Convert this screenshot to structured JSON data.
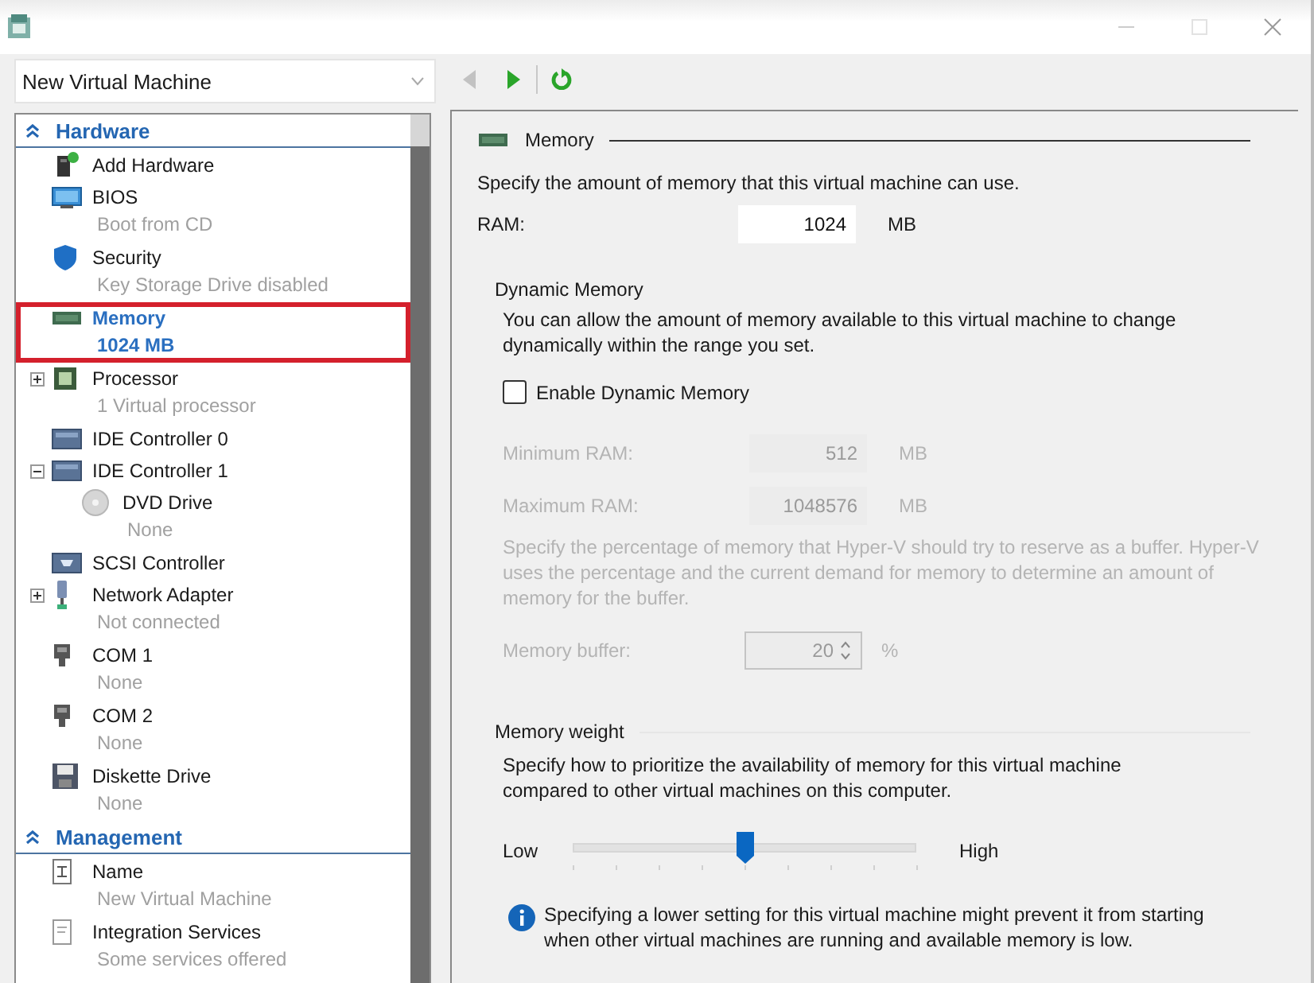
{
  "window": {
    "machine": "New Virtual Machine"
  },
  "toolbar": [
    {
      "kind": "back",
      "disabled": true
    },
    {
      "kind": "forward",
      "disabled": false
    },
    {
      "kind": "refresh",
      "disabled": false
    }
  ],
  "tree": {
    "sections": [
      {
        "title": "Hardware",
        "expanded": true,
        "items": [
          {
            "kind": "hardware",
            "name": "Add Hardware",
            "selected": false
          },
          {
            "kind": "bios",
            "name": "BIOS",
            "detail": "Boot from CD",
            "selected": false
          },
          {
            "kind": "security",
            "name": "Security",
            "detail": "Key Storage Drive disabled",
            "selected": false
          },
          {
            "kind": "memory",
            "name": "Memory",
            "detail": "1024 MB",
            "selected": true
          },
          {
            "kind": "processor",
            "name": "Processor",
            "detail": "1 Virtual processor",
            "selected": false,
            "expanded": false
          },
          {
            "kind": "controller",
            "name": "IDE Controller 0",
            "selected": false
          },
          {
            "kind": "controller",
            "name": "IDE Controller 1",
            "selected": false,
            "expanded": true,
            "children": [
              {
                "kind": "disc",
                "name": "DVD Drive",
                "detail": "None",
                "selected": false
              }
            ]
          },
          {
            "kind": "scsi",
            "name": "SCSI Controller",
            "selected": false
          },
          {
            "kind": "network",
            "name": "Network Adapter",
            "detail": "Not connected",
            "selected": false,
            "expanded": false
          },
          {
            "kind": "port",
            "name": "COM 1",
            "detail": "None",
            "selected": false
          },
          {
            "kind": "port",
            "name": "COM 2",
            "detail": "None",
            "selected": false
          },
          {
            "kind": "diskette",
            "name": "Diskette Drive",
            "detail": "None",
            "selected": false
          }
        ]
      },
      {
        "title": "Management",
        "expanded": true,
        "items": [
          {
            "kind": "name",
            "name": "Name",
            "detail": "New Virtual Machine",
            "selected": false
          },
          {
            "kind": "services",
            "name": "Integration Services",
            "detail": "Some services offered",
            "selected": false
          }
        ]
      }
    ]
  },
  "settings": {
    "title": "Memory",
    "intro": "Specify the amount of memory that this virtual machine can use.",
    "ram": {
      "label": "RAM:",
      "value": "1024",
      "unit": "MB"
    },
    "dynamic": {
      "title": "Dynamic Memory",
      "description": "You can allow the amount of memory available to this virtual machine to change dynamically within the range you set.",
      "checkbox": {
        "label": "Enable Dynamic Memory",
        "checked": false
      },
      "fields": [
        {
          "label": "Minimum RAM:",
          "value": "512",
          "unit": "MB",
          "disabled": true
        },
        {
          "label": "Maximum RAM:",
          "value": "1048576",
          "unit": "MB",
          "disabled": true
        }
      ],
      "buffer_description": {
        "text": "Specify the percentage of memory that Hyper-V should try to reserve as a buffer. Hyper-V uses the percentage and the current demand for memory to determine an amount of memory for the buffer.",
        "disabled": true
      },
      "buffer": {
        "label": "Memory buffer:",
        "value": "20",
        "unit": "%",
        "disabled": true
      }
    },
    "weight": {
      "title": "Memory weight",
      "description": "Specify how to prioritize the availability of memory for this virtual machine compared to other virtual machines on this computer.",
      "slider": {
        "low_label": "Low",
        "high_label": "High",
        "level": 0.5
      },
      "note": "Specifying a lower setting for this virtual machine might prevent it from starting when other virtual machines are running and available memory is low."
    }
  }
}
